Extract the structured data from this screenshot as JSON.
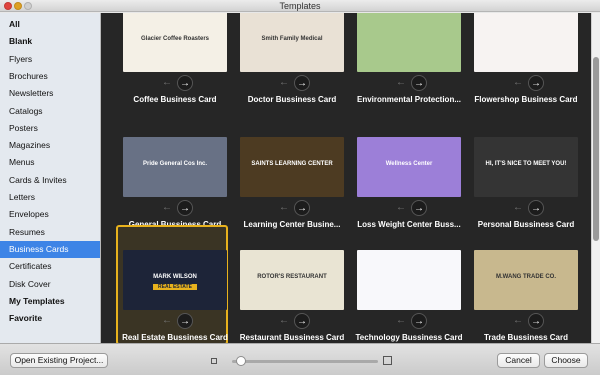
{
  "window": {
    "title": "Templates"
  },
  "sidebar": {
    "items": [
      {
        "label": "All",
        "bold": true
      },
      {
        "label": "Blank",
        "bold": true
      },
      {
        "label": "Flyers"
      },
      {
        "label": "Brochures"
      },
      {
        "label": "Newsletters"
      },
      {
        "label": "Catalogs"
      },
      {
        "label": "Posters"
      },
      {
        "label": "Magazines"
      },
      {
        "label": "Menus"
      },
      {
        "label": "Cards & Invites"
      },
      {
        "label": "Letters"
      },
      {
        "label": "Envelopes"
      },
      {
        "label": "Resumes"
      },
      {
        "label": "Business Cards",
        "selected": true
      },
      {
        "label": "Certificates"
      },
      {
        "label": "Disk Cover"
      },
      {
        "label": "My Templates",
        "bold": true
      },
      {
        "label": "Favorite",
        "bold": true
      }
    ]
  },
  "templates": [
    {
      "label": "Coffee Business Card",
      "card_text": "Glacier Coffee Roasters",
      "bg": "#f4f0e6"
    },
    {
      "label": "Doctor Bussiness Card",
      "card_text": "Smith Family Medical",
      "bg": "#e9e1d5"
    },
    {
      "label": "Environmental Protection...",
      "card_text": "",
      "bg": "#a8c98c"
    },
    {
      "label": "Flowershop Business Card",
      "card_text": "",
      "bg": "#f7f3f2"
    },
    {
      "label": "General Bussiness Card",
      "card_text": "Pride General Cos Inc.",
      "bg": "#687185"
    },
    {
      "label": "Learning Center Busine...",
      "card_text": "SAINTS LEARNING CENTER",
      "bg": "#4d3b22"
    },
    {
      "label": "Loss Weight Center Buss...",
      "card_text": "Wellness Center",
      "bg": "#9c7fd8"
    },
    {
      "label": "Personal Bussiness Card",
      "card_text": "HI, IT'S NICE TO MEET YOU!",
      "bg": "#343434"
    },
    {
      "label": "Real Estate Bussiness Card",
      "card_text": "MARK WILSON",
      "card_subtext": "REAL ESTATE",
      "bg": "#1d2438",
      "selected": true
    },
    {
      "label": "Restaurant Bussiness Card",
      "card_text": "ROTOR'S RESTAURANT",
      "bg": "#e9e4d3"
    },
    {
      "label": "Technology Bussiness Card",
      "card_text": "",
      "bg": "#f8f8fb"
    },
    {
      "label": "Trade Bussiness Card",
      "card_text": "M.WANG TRADE CO.",
      "bg": "#c8b88e"
    }
  ],
  "nav": {
    "prev_glyph": "←",
    "next_glyph": "→"
  },
  "footer": {
    "open_label": "Open Existing Project...",
    "cancel_label": "Cancel",
    "choose_label": "Choose",
    "zoom_level": 0.03
  }
}
